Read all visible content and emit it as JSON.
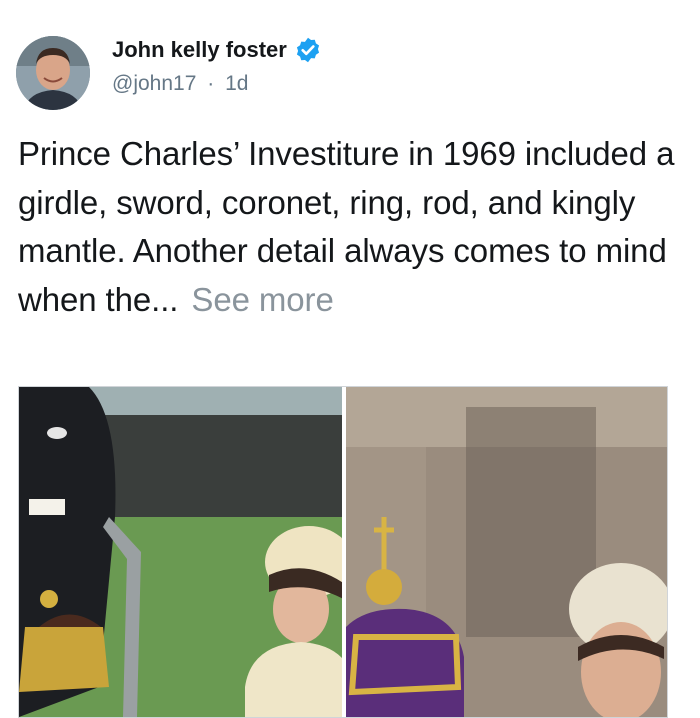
{
  "tweet": {
    "author_name": "John kelly foster",
    "handle": "@john17",
    "separator": "·",
    "time": "1d",
    "text": "Prince Charles’ Investiture in 1969 included a girdle, sword, coronet, ring, rod, and kingly mantle. Another detail always comes to mind when the...",
    "see_more": "See more"
  },
  "icons": {
    "verified": "verified-badge-icon"
  },
  "colors": {
    "name": "#14171a",
    "secondary": "#657786",
    "verified": "#1da1f2",
    "see_more": "#8a949c"
  },
  "media": {
    "count": 2,
    "images": [
      {
        "description_name": "investiture-photo-left"
      },
      {
        "description_name": "investiture-photo-right"
      }
    ]
  }
}
